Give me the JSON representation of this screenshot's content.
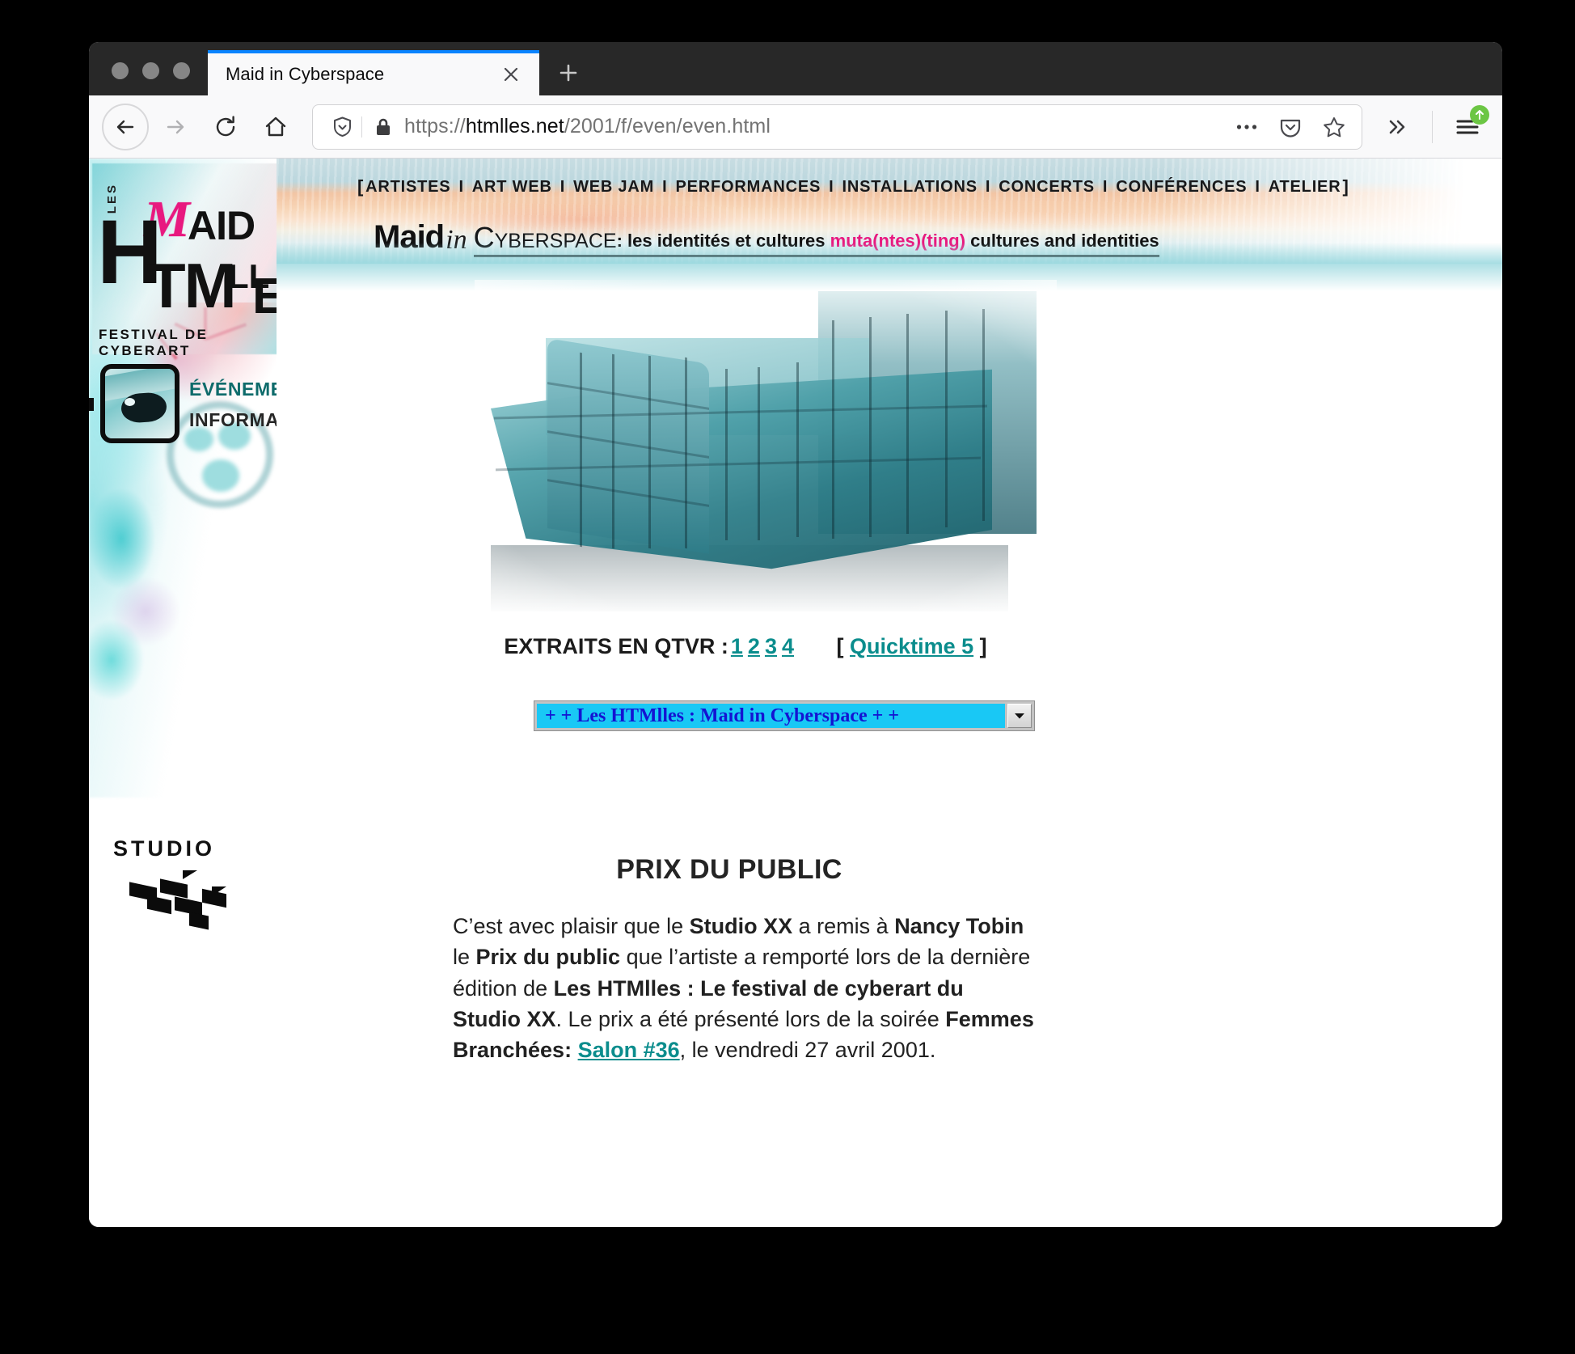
{
  "browser": {
    "tab": {
      "title": "Maid in Cyberspace",
      "close_label": "×",
      "new_tab_label": "+"
    },
    "nav": {
      "back": "back-arrow",
      "forward": "forward-arrow",
      "reload": "reload",
      "home": "home"
    },
    "urlbar": {
      "shield": "shield-icon",
      "lock": "lock-icon",
      "url_scheme": "https://",
      "url_host": "htmlles.net",
      "url_path": "/2001/f/even/even.html",
      "url_full": "https://htmlles.net/2001/f/even/even.html",
      "actions": [
        "page-actions-ellipsis",
        "pocket",
        "bookmark-star"
      ]
    },
    "toolbar": {
      "overflow": "»",
      "menu": "hamburger",
      "update_badge": "update-available"
    }
  },
  "page": {
    "sidebar": {
      "logo": {
        "les": "LES",
        "maid_script": "M",
        "maid_rest": "AID",
        "h": "H",
        "tm": "TM",
        "lles": "LL",
        "es": "ES",
        "festival": "FESTIVAL DE CYBERART"
      },
      "eye_button": "eye-icon",
      "menu": [
        {
          "label": "ÉVÉNEMENTS",
          "color": "#0e6b6b"
        },
        {
          "label": "INFORMATION",
          "color": "#262626"
        }
      ],
      "studio": {
        "word": "STUDIO",
        "mark": "xx-checker-logo"
      }
    },
    "banner": {
      "nav_open": "[",
      "nav_close": "]",
      "nav_sep": "I",
      "nav_items": [
        "ARTISTES",
        "ART WEB",
        "WEB JAM",
        "PERFORMANCES",
        "INSTALLATIONS",
        "CONCERTS",
        "CONFÉRENCES",
        "ATELIER"
      ],
      "title_maid": "Maid",
      "title_in": "in",
      "title_cyberspace": "Cyberspace",
      "tagline_pre": ": les identités et cultures ",
      "tagline_muta": "muta(ntes)(ting)",
      "tagline_post": " cultures and identities"
    },
    "main": {
      "photo_alt": "studio-xx-building-photo",
      "qtvr_label": "EXTRAITS EN QTVR :",
      "qtvr_links": [
        "1",
        "2",
        "3",
        "4"
      ],
      "qtvr_bracket_open": "[",
      "qtvr_quicktime": "Quicktime 5",
      "qtvr_bracket_close": "]",
      "select_value": "+ + Les HTMlles : Maid in Cyberspace + +",
      "select_arrow": "▼",
      "prix_title": "PRIX DU PUBLIC",
      "prix_body": {
        "s1": "C’est avec plaisir que le ",
        "b1": "Studio XX",
        "s2": " a remis à ",
        "b2": "Nancy Tobin",
        "s3": " le ",
        "b3": "Prix du public",
        "s4": " que l’artiste a remporté lors de la dernière édition de ",
        "b4": "Les HTMlles : Le festival de cyberart du Studio XX",
        "s5": ". Le prix a été présenté lors de la soirée ",
        "b5": "Femmes Branchées:",
        "link": "Salon #36",
        "s6": ", le vendredi 27 avril 2001."
      }
    }
  },
  "colors": {
    "accent_teal": "#0b8d8d",
    "magenta": "#e8197f",
    "select_cyan": "#19c8f5",
    "select_text": "#1414d2",
    "tab_accent": "#0a84ff",
    "update_green": "#6cc644"
  }
}
